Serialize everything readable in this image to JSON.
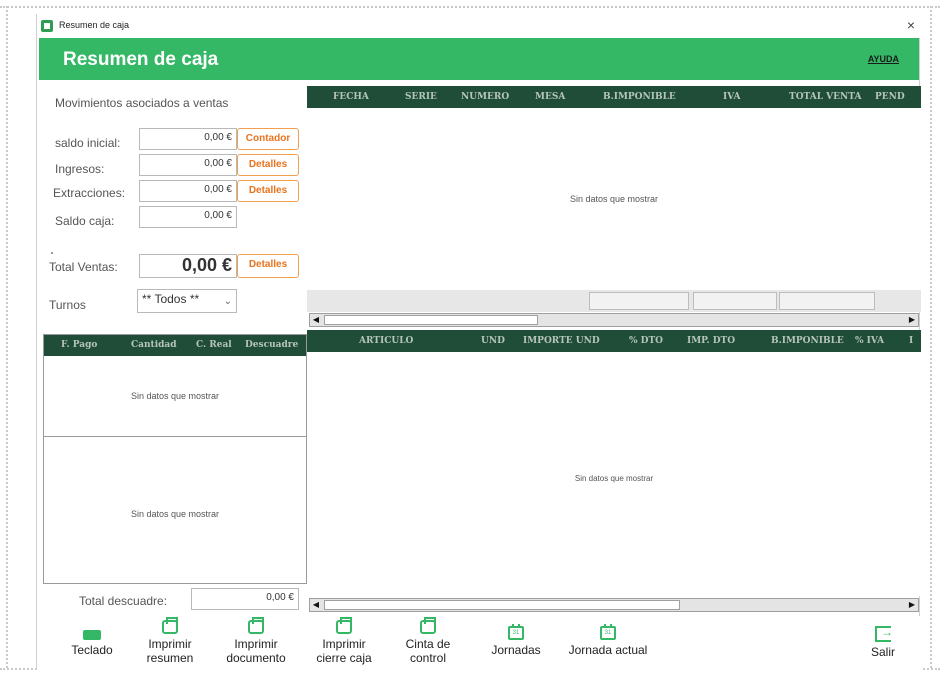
{
  "window": {
    "title": "Resumen de caja",
    "close_glyph": "×"
  },
  "header": {
    "title": "Resumen de caja",
    "help_label": "AYUDA"
  },
  "left_panel": {
    "section_title": "Movimientos asociados a ventas",
    "fields": {
      "saldo_inicial": {
        "label": "saldo inicial:",
        "value": "0,00 €",
        "button": "Contador"
      },
      "ingresos": {
        "label": "Ingresos:",
        "value": "0,00 €",
        "button": "Detalles"
      },
      "extracciones": {
        "label": "Extracciones:",
        "value": "0,00 €",
        "button": "Detalles"
      },
      "saldo_caja": {
        "label": "Saldo caja:",
        "value": "0,00 €"
      },
      "total_ventas": {
        "label": "Total Ventas:",
        "value": "0,00 €",
        "button": "Detalles"
      }
    },
    "turnos": {
      "label": "Turnos",
      "selected": "** Todos **"
    },
    "total_descuadre": {
      "label": "Total descuadre:",
      "value": "0,00 €"
    }
  },
  "payments_grid": {
    "columns": [
      "F. Pago",
      "Cantidad",
      "C. Real",
      "Descuadre"
    ],
    "empty_top": "Sin datos que mostrar",
    "empty_bottom": "Sin datos que mostrar"
  },
  "sales_grid": {
    "columns": [
      "FECHA",
      "SERIE",
      "NUMERO",
      "MESA",
      "B.IMPONIBLE",
      "IVA",
      "TOTAL VENTA",
      "PEND"
    ],
    "empty": "Sin datos que mostrar"
  },
  "items_grid": {
    "columns": [
      "ARTICULO",
      "UND",
      "IMPORTE UND",
      "% DTO",
      "IMP. DTO",
      "B.IMPONIBLE",
      "% IVA",
      "I"
    ],
    "empty": "Sin datos que mostrar"
  },
  "toolbar": {
    "keyboard": {
      "label": "Teclado",
      "icon": "keyboard-icon"
    },
    "print_summary": {
      "line1": "Imprimir",
      "line2": "resumen",
      "icon": "printer-icon"
    },
    "print_document": {
      "line1": "Imprimir",
      "line2": "documento",
      "icon": "printer-icon"
    },
    "print_close": {
      "line1": "Imprimir",
      "line2": "cierre caja",
      "icon": "printer-icon"
    },
    "control_tape": {
      "line1": "Cinta de",
      "line2": "control",
      "icon": "printer-icon"
    },
    "workdays": {
      "label": "Jornadas",
      "icon": "calendar-icon",
      "day": "31"
    },
    "current_workday": {
      "label": "Jornada actual",
      "icon": "calendar-icon",
      "day": "31"
    },
    "exit": {
      "label": "Salir",
      "icon": "exit-icon"
    }
  },
  "colors": {
    "accent": "#34b866",
    "grid_header": "#1f4d37",
    "button_orange": "#e8731f"
  }
}
